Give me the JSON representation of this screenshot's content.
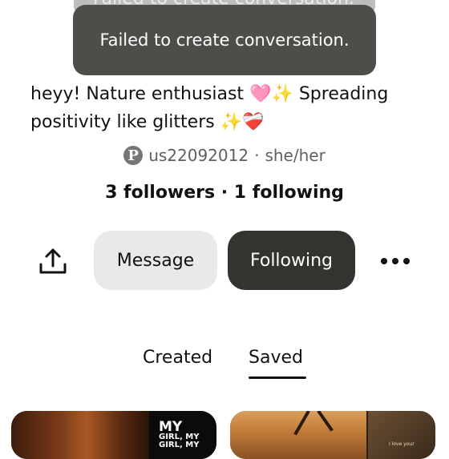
{
  "toast": {
    "message": "Failed to create conversation."
  },
  "profile": {
    "bio_line1": "heyy! Nature enthusiast 🩷✨ Spreading",
    "bio_line2": "positivity like glitters ✨❤️‍🩹",
    "username": "us22092012",
    "pronouns": "she/her",
    "pin_logo": "P",
    "stats": "3 followers · 1 following"
  },
  "actions": {
    "message_label": "Message",
    "following_label": "Following",
    "share_icon": "share-icon",
    "more_icon": "more-options-icon"
  },
  "tabs": [
    {
      "label": "Created",
      "active": false
    },
    {
      "label": "Saved",
      "active": true
    }
  ],
  "pins": [
    {
      "title": "MY",
      "subtitle": "GIRL, MY GIRL, MY"
    },
    {
      "caption": "I love your"
    }
  ],
  "colors": {
    "primary_button": "#33332f",
    "secondary_button": "#e9e9e7",
    "toast_bg": "#4d4d4a"
  }
}
